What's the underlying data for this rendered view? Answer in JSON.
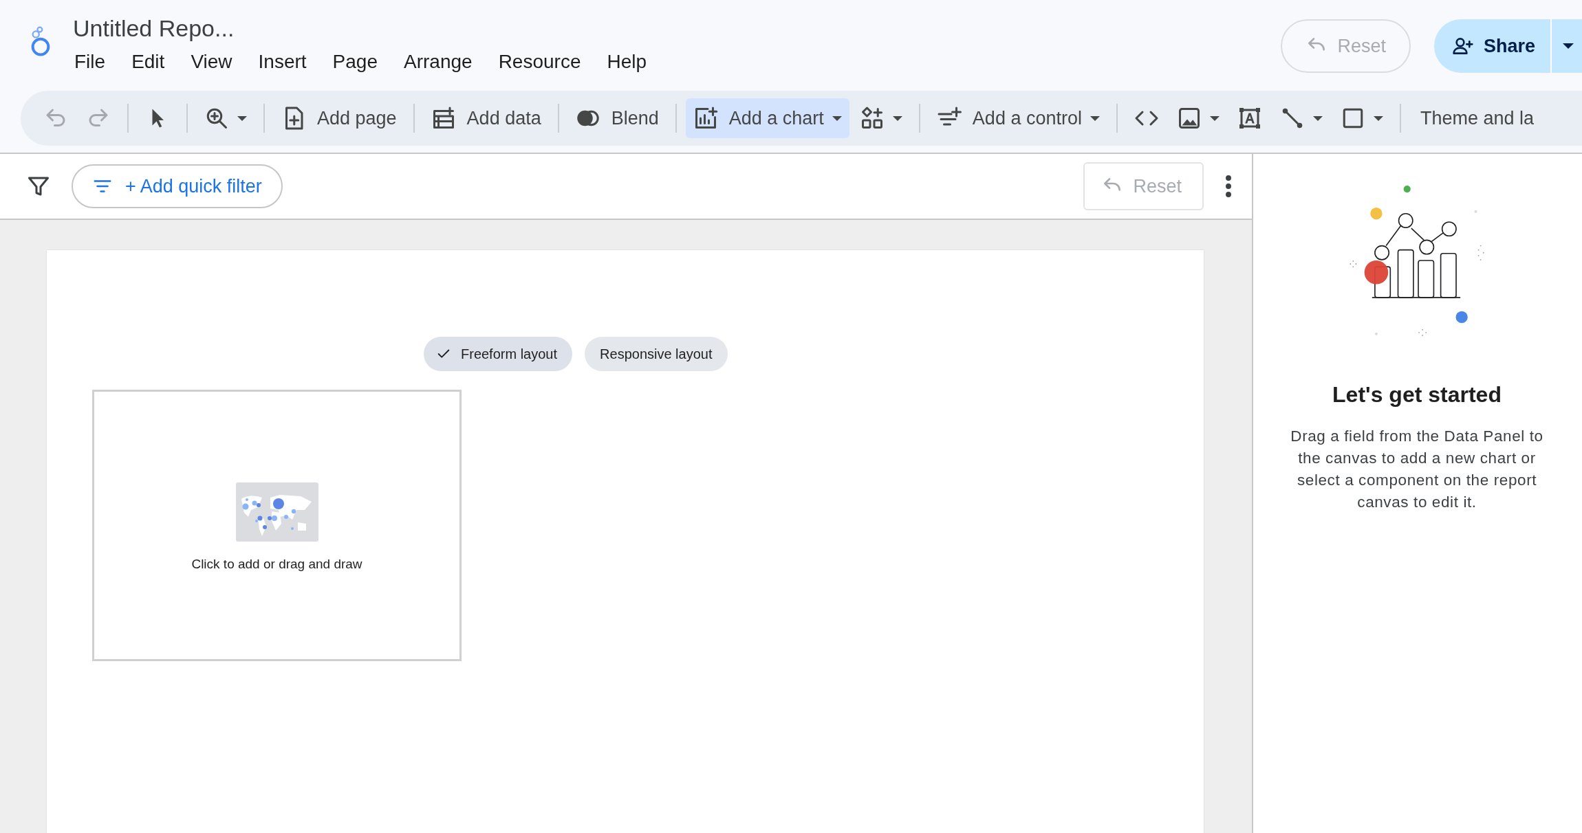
{
  "app": {
    "title": "Untitled Repo...",
    "menu": [
      "File",
      "Edit",
      "View",
      "Insert",
      "Page",
      "Arrange",
      "Resource",
      "Help"
    ]
  },
  "header_actions": {
    "reset": {
      "label": "Reset",
      "disabled": true
    },
    "share": {
      "label": "Share"
    }
  },
  "toolbar": {
    "groups": [
      {
        "items": [
          {
            "kind": "undo",
            "dropdown": false,
            "selected": false,
            "disabled": true
          },
          {
            "kind": "redo",
            "dropdown": false,
            "selected": false,
            "disabled": true
          }
        ]
      },
      {
        "items": [
          {
            "kind": "select",
            "dropdown": false,
            "selected": false,
            "disabled": false
          }
        ]
      },
      {
        "items": [
          {
            "kind": "zoom",
            "dropdown": true,
            "selected": false,
            "disabled": false
          }
        ]
      },
      {
        "items": [
          {
            "kind": "add_page",
            "label": "Add page",
            "dropdown": false,
            "selected": false,
            "disabled": false
          }
        ]
      },
      {
        "items": [
          {
            "kind": "add_data",
            "label": "Add data",
            "dropdown": false,
            "selected": false,
            "disabled": false
          }
        ]
      },
      {
        "items": [
          {
            "kind": "blend",
            "label": "Blend",
            "dropdown": false,
            "selected": false,
            "disabled": false
          }
        ]
      },
      {
        "items": [
          {
            "kind": "add_chart",
            "label": "Add a chart",
            "dropdown": true,
            "selected": true,
            "disabled": false
          },
          {
            "kind": "community",
            "dropdown": true,
            "selected": false,
            "disabled": false
          }
        ]
      },
      {
        "items": [
          {
            "kind": "add_control",
            "label": "Add a control",
            "dropdown": true,
            "selected": false,
            "disabled": false
          }
        ]
      },
      {
        "items": [
          {
            "kind": "code",
            "dropdown": false,
            "selected": false,
            "disabled": false
          },
          {
            "kind": "image",
            "dropdown": true,
            "selected": false,
            "disabled": false
          },
          {
            "kind": "text",
            "dropdown": false,
            "selected": false,
            "disabled": false
          },
          {
            "kind": "line",
            "dropdown": true,
            "selected": false,
            "disabled": false
          },
          {
            "kind": "shape",
            "dropdown": true,
            "selected": false,
            "disabled": false
          }
        ]
      },
      {
        "items": [
          {
            "kind": "theme",
            "label": "Theme and la",
            "dropdown": false,
            "selected": false,
            "disabled": false
          }
        ]
      }
    ]
  },
  "filter_bar": {
    "add_filter": "+ Add quick filter",
    "reset": {
      "label": "Reset",
      "disabled": true
    }
  },
  "canvas": {
    "layouts": [
      {
        "label": "Freeform layout",
        "selected": true
      },
      {
        "label": "Responsive layout",
        "selected": false
      }
    ],
    "placeholder": {
      "caption": "Click to add or drag and draw"
    }
  },
  "side_panel": {
    "heading": "Let's get started",
    "body": "Drag a field from the Data Panel to the canvas to add a new chart or select a component on the report canvas to edit it."
  }
}
